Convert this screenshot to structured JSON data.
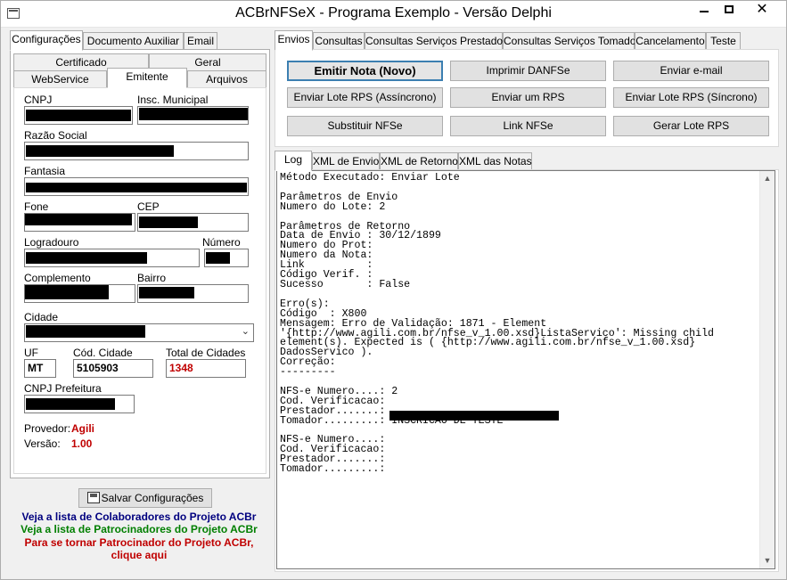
{
  "window": {
    "title": "ACBrNFSeX - Programa Exemplo - Versão Delphi",
    "minimize": "—",
    "maximize": "□",
    "close": "✕"
  },
  "left": {
    "top_tabs": [
      "Configurações",
      "Documento Auxiliar",
      "Email"
    ],
    "sub_tabs_row1": [
      "Certificado",
      "Geral"
    ],
    "sub_tabs_row2": [
      "WebService",
      "Emitente",
      "Arquivos"
    ],
    "labels": {
      "cnpj": "CNPJ",
      "insc_municipal": "Insc. Municipal",
      "razao_social": "Razão Social",
      "fantasia": "Fantasia",
      "fone": "Fone",
      "cep": "CEP",
      "logradouro": "Logradouro",
      "numero": "Número",
      "complemento": "Complemento",
      "bairro": "Bairro",
      "cidade": "Cidade",
      "uf": "UF",
      "cod_cidade": "Cód. Cidade",
      "total_cidades": "Total de Cidades",
      "cnpj_prefeitura": "CNPJ Prefeitura",
      "provedor": "Provedor:",
      "versao": "Versão:"
    },
    "values": {
      "uf": "MT",
      "cod_cidade": "5105903",
      "total_cidades": "1348",
      "provedor": "Agili",
      "versao": "1.00"
    },
    "save_button": "Salvar Configurações",
    "links": {
      "colaboradores": "Veja a lista de Colaboradores do Projeto ACBr",
      "patrocinadores": "Veja a lista de Patrocinadores do Projeto ACBr",
      "tornar_1": "Para se tornar Patrocinador do Projeto ACBr,",
      "tornar_2": "clique aqui"
    },
    "colors": {
      "colaboradores": "#00007f",
      "patrocinadores": "#007f00",
      "tornar": "#c00000"
    }
  },
  "right": {
    "top_tabs": [
      "Envios",
      "Consultas",
      "Consultas Serviços Prestados",
      "Consultas Serviços Tomados",
      "Cancelamento",
      "Teste"
    ],
    "buttons": {
      "emitir_nota": "Emitir Nota (Novo)",
      "imprimir_danfse": "Imprimir DANFSe",
      "enviar_email": "Enviar e-mail",
      "enviar_lote_assincrono": "Enviar Lote RPS (Assíncrono)",
      "enviar_um_rps": "Enviar um RPS",
      "enviar_lote_sincrono": "Enviar Lote RPS (Síncrono)",
      "substituir_nfse": "Substituir NFSe",
      "link_nfse": "Link NFSe",
      "gerar_lote_rps": "Gerar Lote RPS"
    },
    "log_tabs": [
      "Log",
      "XML de Envio",
      "XML de Retorno",
      "XML das Notas"
    ],
    "log_text": "Método Executado: Enviar Lote\n\nParâmetros de Envio\nNumero do Lote: 2\n\nParâmetros de Retorno\nData de Envio : 30/12/1899\nNumero do Prot:\nNumero da Nota:\nLink          :\nCódigo Verif. :\nSucesso       : False\n\nErro(s):\nCódigo  : X800\nMensagem: Erro de Validação: 1871 - Element\n'{http://www.agili.com.br/nfse_v_1.00.xsd}ListaServico': Missing child\nelement(s). Expected is ( {http://www.agili.com.br/nfse_v_1.00.xsd}\nDadosServico ).\nCorreção:\n---------\n\nNFS-e Numero....: 2\nCod. Verificacao:\nPrestador.......:\nTomador.........: INSCRICAO DE TESTE\n\nNFS-e Numero....:\nCod. Verificacao:\nPrestador.......:\nTomador.........:"
  }
}
